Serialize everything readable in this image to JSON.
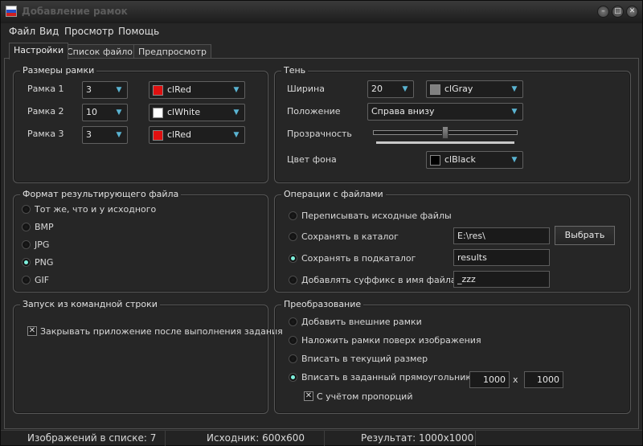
{
  "window": {
    "title": "Добавление рамок"
  },
  "menu": [
    "Файл",
    "Вид",
    "Просмотр",
    "Помощь"
  ],
  "tabs": [
    "Настройки",
    "Список файлов",
    "Предпросмотр"
  ],
  "frames": {
    "legend": "Размеры рамки",
    "rows": [
      {
        "label": "Рамка 1",
        "size": "3",
        "color_name": "clRed",
        "color": "#e01010"
      },
      {
        "label": "Рамка 2",
        "size": "10",
        "color_name": "clWhite",
        "color": "#ffffff"
      },
      {
        "label": "Рамка 3",
        "size": "3",
        "color_name": "clRed",
        "color": "#e01010"
      }
    ]
  },
  "shadow": {
    "legend": "Тень",
    "width_label": "Ширина",
    "width_value": "20",
    "width_color_name": "clGray",
    "width_color": "#808080",
    "position_label": "Положение",
    "position_value": "Справа внизу",
    "transparency_label": "Прозрачность",
    "transparency_fraction": 0.5,
    "bg_label": "Цвет фона",
    "bg_color_name": "clBlack",
    "bg_color": "#000000"
  },
  "format": {
    "legend": "Формат результирующего файла",
    "options": [
      "Тот же, что и у исходного",
      "BMP",
      "JPG",
      "PNG",
      "GIF"
    ],
    "selected": 3
  },
  "fileops": {
    "legend": "Операции с файлами",
    "options": [
      "Переписывать исходные файлы",
      "Сохранять в каталог",
      "Сохранять в подкаталог",
      "Добавлять суффикс в имя файла"
    ],
    "selected": 2,
    "catalog_value": "E:\\res\\",
    "browse_label": "Выбрать",
    "subfolder_value": "results",
    "suffix_value": "_zzz"
  },
  "cmdline": {
    "legend": "Запуск из командной строки",
    "close_label": "Закрывать приложение после выполнения задания",
    "close_checked": true
  },
  "transform": {
    "legend": "Преобразование",
    "options": [
      "Добавить внешние рамки",
      "Наложить рамки поверх изображения",
      "Вписать в текущий размер",
      "Вписать в заданный прямоугольник"
    ],
    "selected": 3,
    "rect_width": "1000",
    "rect_x": "x",
    "rect_height": "1000",
    "proportions_label": "С учётом пропорций",
    "proportions_checked": true
  },
  "status": {
    "images": "Изображений в списке: 7",
    "source": "Исходник: 600x600",
    "result": "Результат: 1000x1000"
  },
  "icons": {
    "app": "flag-icon",
    "minimize": "minimize-icon",
    "restore": "restore-icon",
    "close": "close-icon",
    "dropdown": "chevron-down-icon",
    "check": "check-mark-icon"
  }
}
